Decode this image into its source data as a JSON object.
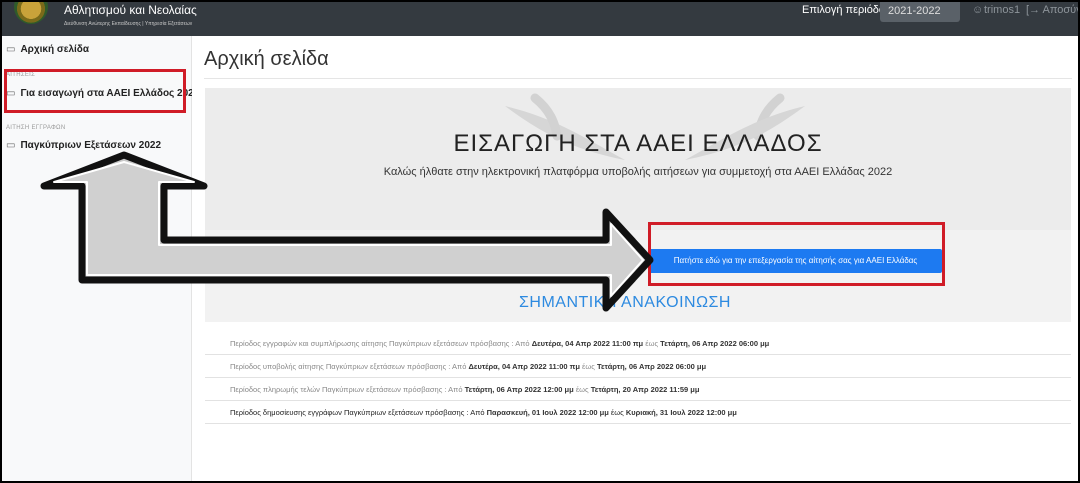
{
  "header": {
    "brand_title": "Αθλητισμού και Νεολαίας",
    "brand_subtitle": "Διεύθυνση Ανώτερης Εκπαίδευσης | Υπηρεσία Εξετάσεων",
    "period_label": "Επιλογή περιόδου:",
    "period_value": "2021-2022",
    "user_name": "trimos1",
    "logout_label": "[→ Αποσύνδεση"
  },
  "sidebar": {
    "home": "Αρχική σελίδα",
    "heading_1": "ΑΙΤΗΣΕΙΣ",
    "aaei": "Για εισαγωγή στα ΑΑΕΙ Ελλάδος 2022",
    "heading_2": "ΑΙΤΗΣΗ ΕΓΓΡΑΦΩΝ",
    "exams": "Παγκύπριων Εξετάσεων 2022"
  },
  "main": {
    "page_title": "Αρχική σελίδα",
    "hero_title": "ΕΙΣΑΓΩΓΗ ΣΤΑ ΑΑΕΙ ΕΛΛΑΔΟΣ",
    "hero_subtitle": "Καλώς ήλθατε στην ηλεκτρονική πλατφόρμα υποβολής αιτήσεων για συμμετοχή στα ΑΑΕΙ Ελλάδας 2022",
    "edit_button": "Πατήστε εδώ για την επεξεργασία της αίτησής σας για ΑΑΕΙ Ελλάδας",
    "notice_title": "ΣΗΜΑΝΤΙΚΗ ΑΝΑΚΟΙΝΩΣΗ",
    "from_label": "Από",
    "to_label": "έως",
    "announcements": [
      {
        "text": "Περίοδος εγγραφών και συμπλήρωσης αίτησης Παγκύπριων εξετάσεων πρόσβασης :",
        "from": "Δευτέρα, 04 Απρ 2022 11:00 πμ",
        "to": "Τετάρτη, 06 Απρ 2022 06:00 μμ"
      },
      {
        "text": "Περίοδος υποβολής αίτησης Παγκύπριων εξετάσεων πρόσβασης :",
        "from": "Δευτέρα, 04 Απρ 2022 11:00 πμ",
        "to": "Τετάρτη, 06 Απρ 2022 06:00 μμ"
      },
      {
        "text": "Περίοδος πληρωμής τελών Παγκύπριων εξετάσεων πρόσβασης :",
        "from": "Τετάρτη, 06 Απρ 2022 12:00 μμ",
        "to": "Τετάρτη, 20 Απρ 2022 11:59 μμ"
      },
      {
        "text": "Περίοδος δημοσίευσης εγγράφων Παγκύπριων εξετάσεων πρόσβασης :",
        "from": "Παρασκευή, 01 Ιουλ 2022 12:00 μμ",
        "to": "Κυριακή, 31 Ιουλ 2022 12:00 μμ"
      }
    ]
  },
  "colors": {
    "navbar": "#343a40",
    "accent_blue": "#1d7af1",
    "highlight_red": "#d01c27",
    "notice_blue": "#2d8ae0"
  },
  "icons": {
    "home": "file-icon",
    "application": "file-icon",
    "user": "user-icon",
    "logout": "logout-icon"
  }
}
